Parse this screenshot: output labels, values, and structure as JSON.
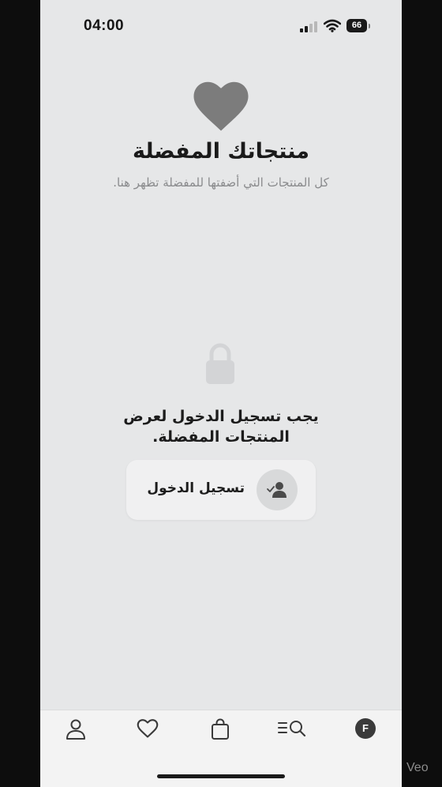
{
  "status_bar": {
    "time": "04:00",
    "battery": "66"
  },
  "favorites": {
    "title": "منتجاتك المفضلة",
    "subtitle": "كل المنتجات التي أضفتها للمفضلة تظهر هنا."
  },
  "login_prompt": {
    "message": "يجب تسجيل الدخول لعرض المنتجات المفضلة.",
    "button_label": "تسجيل الدخول"
  },
  "tab_bar": {
    "items": [
      {
        "icon": "person-icon"
      },
      {
        "icon": "heart-icon"
      },
      {
        "icon": "shopping-bag-icon"
      },
      {
        "icon": "menu-search-icon"
      },
      {
        "icon": "avatar",
        "initial": "F"
      }
    ]
  },
  "watermark": "Veo",
  "colors": {
    "background": "#e6e7e8",
    "heart": "#7c7c7c",
    "text": "#1a1a1a",
    "muted_text": "#8a8b8d"
  }
}
